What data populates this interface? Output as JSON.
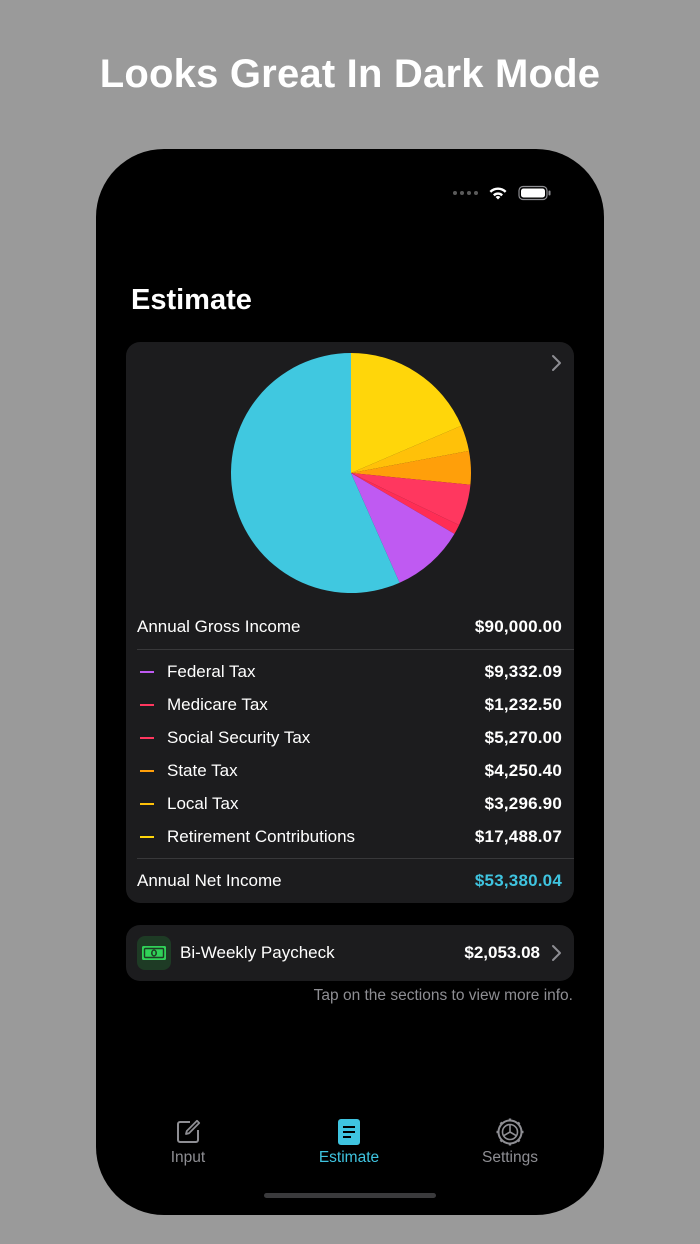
{
  "headline": "Looks Great In Dark Mode",
  "screen_title": "Estimate",
  "pie": {
    "slices": [
      {
        "name": "Retirement Contributions",
        "value": 17488.07,
        "color": "#ffd60a"
      },
      {
        "name": "Local Tax",
        "value": 3296.9,
        "color": "#ffc109"
      },
      {
        "name": "State Tax",
        "value": 4250.4,
        "color": "#ff9f0a"
      },
      {
        "name": "Social Security Tax",
        "value": 5270.0,
        "color": "#ff375f"
      },
      {
        "name": "Medicare Tax",
        "value": 1232.5,
        "color": "#ff2d55"
      },
      {
        "name": "Federal Tax",
        "value": 9332.09,
        "color": "#bf5af2"
      },
      {
        "name": "Annual Net Income",
        "value": 53380.04,
        "color": "#40c8e0"
      }
    ]
  },
  "gross": {
    "label": "Annual Gross Income",
    "value": "$90,000.00"
  },
  "items": [
    {
      "label": "Federal Tax",
      "value": "$9,332.09",
      "color": "#bf5af2"
    },
    {
      "label": "Medicare Tax",
      "value": "$1,232.50",
      "color": "#ff375f"
    },
    {
      "label": "Social Security Tax",
      "value": "$5,270.00",
      "color": "#ff375f"
    },
    {
      "label": "State Tax",
      "value": "$4,250.40",
      "color": "#ff9f0a"
    },
    {
      "label": "Local Tax",
      "value": "$3,296.90",
      "color": "#ffc109"
    },
    {
      "label": "Retirement Contributions",
      "value": "$17,488.07",
      "color": "#ffd60a"
    }
  ],
  "net": {
    "label": "Annual Net Income",
    "value": "$53,380.04",
    "color": "#3fc4e0"
  },
  "paycheck": {
    "icon": "money-icon",
    "label": "Bi-Weekly Paycheck",
    "value": "$2,053.08"
  },
  "hint": "Tap on the sections to view more info.",
  "tabs": [
    {
      "label": "Input",
      "icon": "edit-icon",
      "active": false
    },
    {
      "label": "Estimate",
      "icon": "document-icon",
      "active": true
    },
    {
      "label": "Settings",
      "icon": "gear-icon",
      "active": false
    }
  ]
}
